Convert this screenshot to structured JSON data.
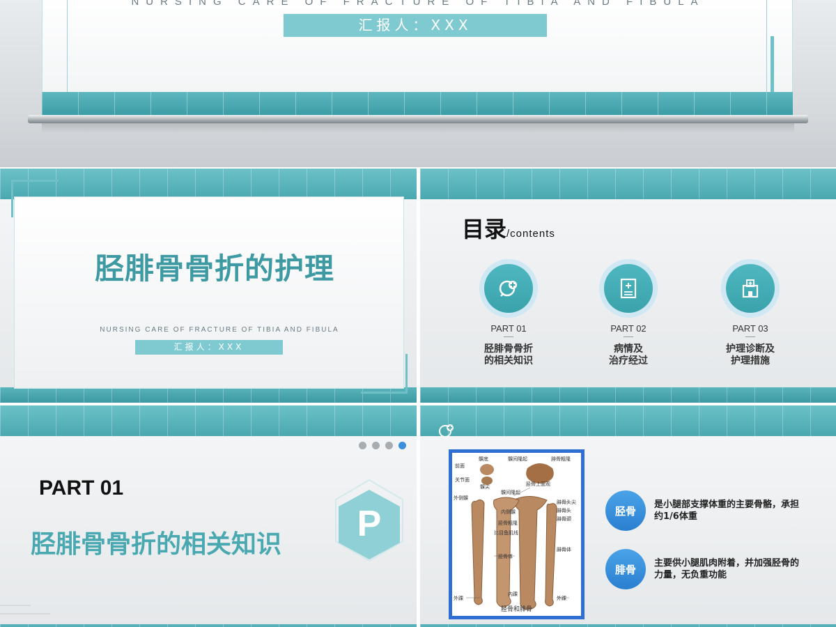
{
  "hero": {
    "subtitle": "NURSING CARE OF FRACTURE OF TIBIA AND FIBULA",
    "reporter": "汇报人：XXX"
  },
  "slide_title": {
    "title": "胫腓骨骨折的护理",
    "subtitle": "NURSING CARE OF FRACTURE OF TIBIA AND FIBULA",
    "reporter": "汇报人：XXX"
  },
  "slide_contents": {
    "heading": "目录",
    "heading_suffix": "/contents",
    "items": [
      {
        "part": "PART 01",
        "title": "胫腓骨骨折\n的相关知识",
        "icon": "medical-plus-icon"
      },
      {
        "part": "PART 02",
        "title": "病情及\n治疗经过",
        "icon": "medical-record-icon"
      },
      {
        "part": "PART 03",
        "title": "护理诊断及\n护理措施",
        "icon": "hospital-icon"
      }
    ]
  },
  "slide_section": {
    "part": "PART 01",
    "title": "胫腓骨骨折的相关知识",
    "hex_letter": "P",
    "pagination_active_index": 3,
    "pagination_count": 4
  },
  "slide_bones": {
    "figure_caption": "胫骨和腓骨",
    "figure_labels": {
      "l1": "前面",
      "l2": "髁底",
      "l3": "髁间隆起",
      "l4": "腓骨粗隆",
      "l5": "关节面",
      "l6": "髁尖",
      "l7": "胫骨上面观",
      "l8": "外侧髁",
      "l9": "髁间隆起",
      "l10": "腓骨头尖",
      "l11": "内侧髁",
      "l12": "腓骨头",
      "l13": "胫骨粗隆",
      "l14": "腓骨颈",
      "l15": "比目鱼肌线",
      "l16": "胫骨体",
      "l17": "腓骨体",
      "l18": "内踝",
      "l19": "外踝",
      "l20": "外踝"
    },
    "items": [
      {
        "badge": "胫骨",
        "desc": "是小腿部支撑体重的主要骨骼，承担约1/6体重"
      },
      {
        "badge": "腓骨",
        "desc": "主要供小腿肌肉附着，并加强胫骨的力量，无负重功能"
      }
    ]
  },
  "colors": {
    "teal": "#4aa8b0",
    "teal_light": "#7fcad0",
    "blue": "#2a7fd0",
    "bone": "#b98a62"
  }
}
